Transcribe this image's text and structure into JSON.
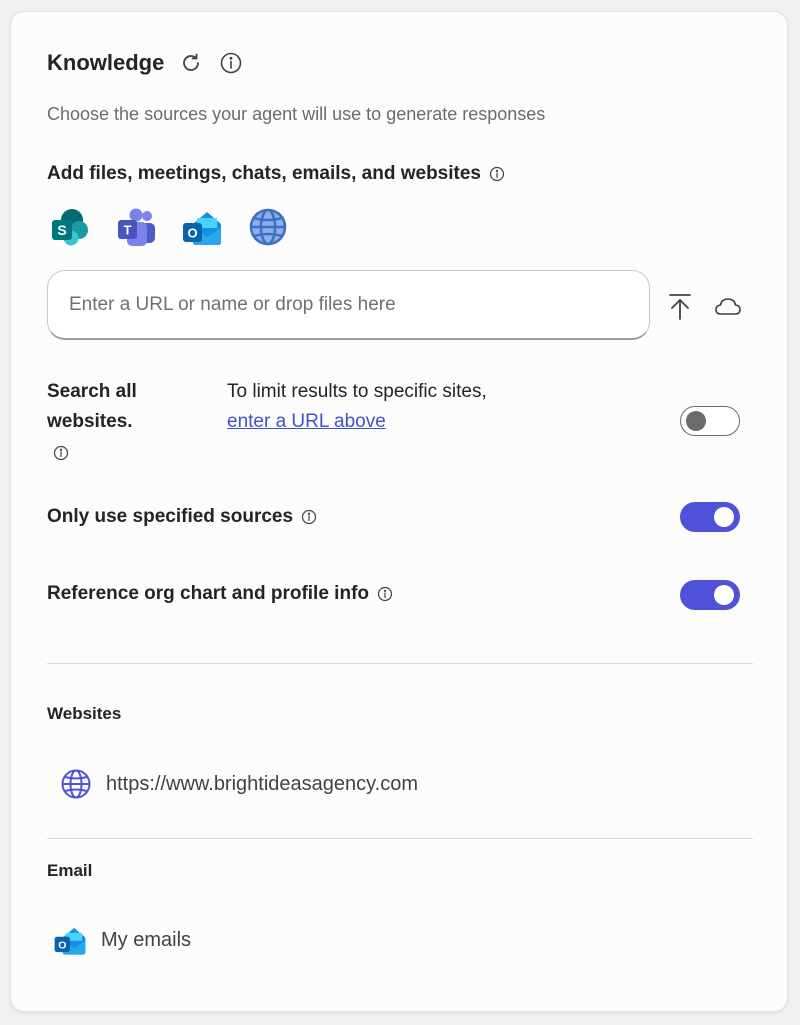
{
  "knowledge": {
    "title": "Knowledge",
    "subtitle": "Choose the sources your agent will use to generate responses",
    "add_sources_heading": "Add files, meetings, chats, emails, and websites",
    "source_icons": [
      "sharepoint-icon",
      "teams-icon",
      "outlook-icon",
      "globe-icon"
    ],
    "url_input": {
      "value": "",
      "placeholder": "Enter a URL or name or drop files here"
    },
    "search_all": {
      "label": "Search all websites.",
      "description": "To limit results to specific sites,",
      "link": "enter a URL above",
      "enabled": false
    },
    "only_specified": {
      "label": "Only use specified sources",
      "enabled": true
    },
    "org_chart": {
      "label": "Reference org chart and profile info",
      "enabled": true
    },
    "websites": {
      "heading": "Websites",
      "items": [
        "https://www.brightideasagency.com"
      ]
    },
    "email": {
      "heading": "Email",
      "items": [
        "My emails"
      ]
    }
  },
  "colors": {
    "accent": "#4f52d8",
    "link": "#4353c4",
    "text": "#242424",
    "muted": "#6b6b6b"
  }
}
